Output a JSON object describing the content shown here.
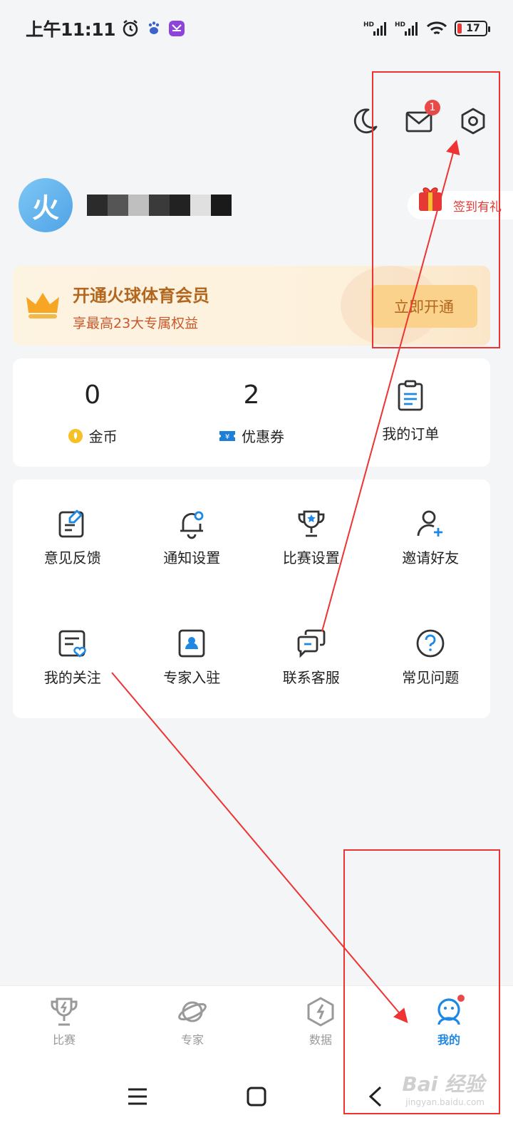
{
  "status": {
    "time": "上午11:11",
    "battery": "17",
    "net1": "HD",
    "net2": "HD"
  },
  "header": {
    "mail_badge": "1"
  },
  "profile": {
    "avatar_char": "火",
    "checkin_label": "签到有礼"
  },
  "vip": {
    "title": "开通火球体育会员",
    "subtitle": "享最高23大专属权益",
    "button": "立即开通"
  },
  "stats": [
    {
      "value": "0",
      "label": "金币"
    },
    {
      "value": "2",
      "label": "优惠券"
    }
  ],
  "orders_label": "我的订单",
  "menu": [
    {
      "label": "意见反馈",
      "icon": "feedback-icon"
    },
    {
      "label": "通知设置",
      "icon": "bell-icon"
    },
    {
      "label": "比赛设置",
      "icon": "trophy-icon"
    },
    {
      "label": "邀请好友",
      "icon": "add-user-icon"
    },
    {
      "label": "我的关注",
      "icon": "follow-list-icon"
    },
    {
      "label": "专家入驻",
      "icon": "expert-badge-icon"
    },
    {
      "label": "联系客服",
      "icon": "chat-icon"
    },
    {
      "label": "常见问题",
      "icon": "question-icon"
    }
  ],
  "nav": [
    {
      "label": "比赛",
      "icon": "trophy-icon"
    },
    {
      "label": "专家",
      "icon": "planet-icon"
    },
    {
      "label": "数据",
      "icon": "data-hex-icon"
    },
    {
      "label": "我的",
      "icon": "profile-icon",
      "active": true
    }
  ],
  "watermark": {
    "text": "Bai 经验",
    "sub": "jingyan.baidu.com"
  },
  "colors": {
    "accent": "#1e88e5",
    "vip_text": "#b3661e",
    "badge": "#e84a4a",
    "annotation": "#e33333"
  }
}
